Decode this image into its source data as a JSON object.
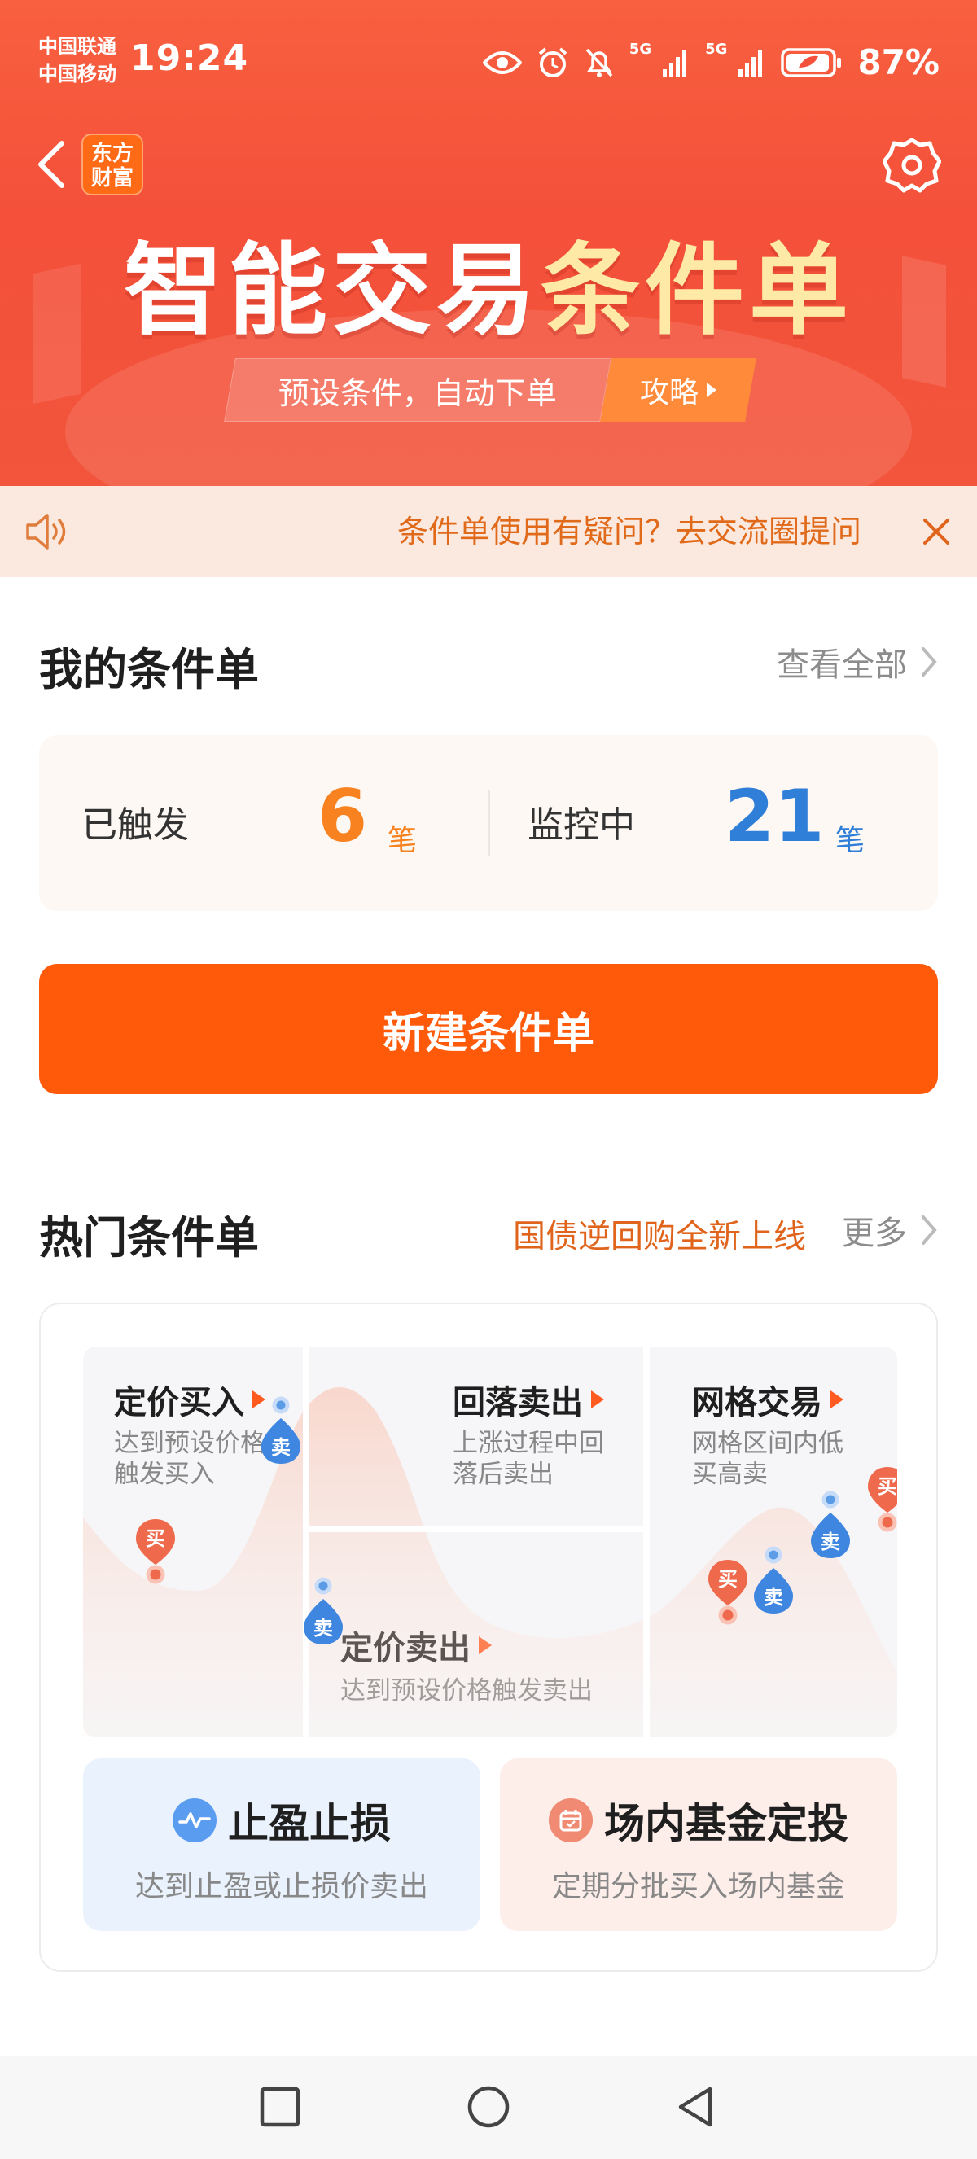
{
  "status_bar": {
    "carrier_1": "中国联通",
    "carrier_2": "中国移动",
    "time": "19:24",
    "network_1": "5G",
    "network_2": "5G",
    "battery": "87%"
  },
  "header": {
    "logo_line1": "东方",
    "logo_line2": "财富",
    "title_white": "智能交易",
    "title_yellow": "条件单",
    "subtitle": "预设条件，自动下单",
    "guide_label": "攻略"
  },
  "notice": {
    "text": "条件单使用有疑问？去交流圈提问"
  },
  "my_orders": {
    "title": "我的条件单",
    "view_all": "查看全部",
    "triggered_label": "已触发",
    "triggered_count": "6",
    "triggered_unit": "笔",
    "monitoring_label": "监控中",
    "monitoring_count": "21",
    "monitoring_unit": "笔"
  },
  "create_button": "新建条件单",
  "hot_orders": {
    "title": "热门条件单",
    "promo": "国债逆回购全新上线",
    "more": "更多",
    "tiles": [
      {
        "title": "定价买入",
        "desc_line1": "达到预设价格",
        "desc_line2": "触发买入"
      },
      {
        "title": "回落卖出",
        "desc_line1": "上涨过程中回",
        "desc_line2": "落后卖出"
      },
      {
        "title": "网格交易",
        "desc_line1": "网格区间内低",
        "desc_line2": "买高卖"
      },
      {
        "title": "定价卖出",
        "desc_line1": "达到预设价格触发卖出"
      }
    ],
    "marker_buy": "买",
    "marker_sell": "卖",
    "features": [
      {
        "title": "止盈止损",
        "desc": "达到止盈或止损价卖出"
      },
      {
        "title": "场内基金定投",
        "desc": "定期分批买入场内基金"
      }
    ]
  },
  "colors": {
    "brand_orange": "#ff5a0a",
    "banner_red": "#f4503a",
    "accent_yellow": "#ffe9a6",
    "count_orange": "#f7821f",
    "count_blue": "#2f7ed8",
    "buy_marker": "#ef6a4c",
    "sell_marker": "#3f86e0"
  }
}
